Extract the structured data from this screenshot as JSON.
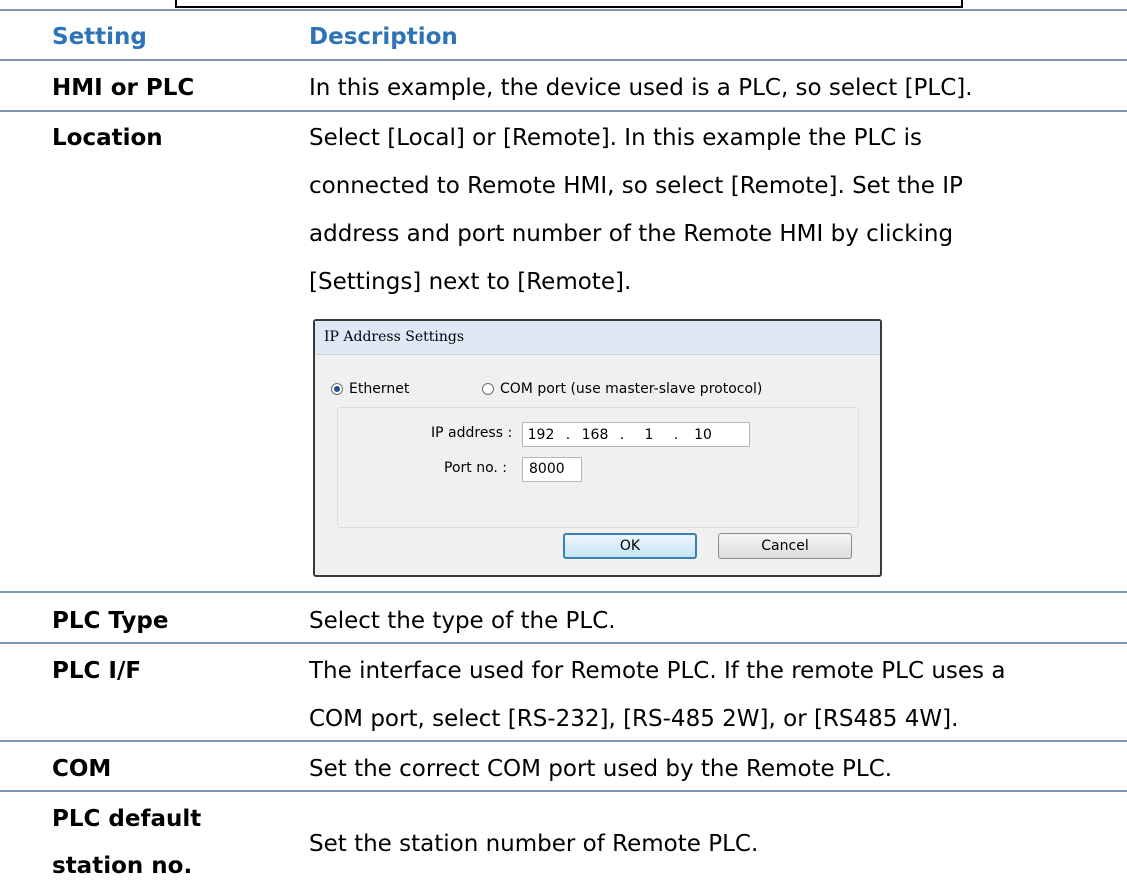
{
  "table": {
    "header": {
      "setting": "Setting",
      "description": "Description"
    },
    "rows": {
      "hmi_or_plc": {
        "label": "HMI or PLC",
        "desc": "In this example, the device used is a PLC, so select [PLC]."
      },
      "location": {
        "label": "Location",
        "desc_lines": [
          "Select [Local] or [Remote]. In this example the PLC is",
          "connected to Remote HMI, so select [Remote]. Set the IP",
          "address and port number of the Remote HMI by clicking",
          "[Settings] next to [Remote]."
        ]
      },
      "plc_type": {
        "label": "PLC Type",
        "desc": "Select the type of the PLC."
      },
      "plc_if": {
        "label": "PLC I/F",
        "desc_lines": [
          "The interface used for Remote PLC. If the remote PLC uses a",
          "COM port, select [RS-232], [RS-485 2W], or [RS485 4W]."
        ]
      },
      "com": {
        "label": "COM",
        "desc": "Set the correct COM port used by the Remote PLC."
      },
      "plc_default_station": {
        "label_lines": [
          "PLC default",
          "station no."
        ],
        "desc": "Set the station number of Remote PLC."
      }
    }
  },
  "dialog": {
    "title": "IP Address Settings",
    "radio_ethernet": "Ethernet",
    "radio_com": "COM port (use master-slave protocol)",
    "selected": "Ethernet",
    "ip_label": "IP address :",
    "ip_octets": [
      "192",
      "168",
      "1",
      "10"
    ],
    "ip_dot": ".",
    "port_label": "Port no. :",
    "port_value": "8000",
    "ok_label": "OK",
    "cancel_label": "Cancel"
  }
}
